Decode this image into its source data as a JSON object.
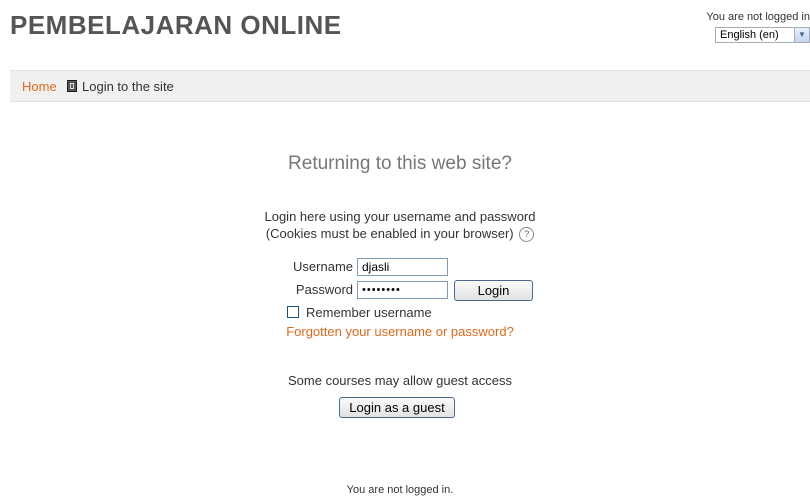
{
  "header": {
    "site_title": "PEMBELAJARAN ONLINE",
    "login_info": "You are not logged in",
    "language_selected": "English (en)"
  },
  "navbar": {
    "home": "Home",
    "current": "Login to the site"
  },
  "login": {
    "heading": "Returning to this web site?",
    "intro": "Login here using your username and password",
    "cookies_note": "(Cookies must be enabled in your browser)",
    "username_label": "Username",
    "username_value": "djasli",
    "password_label": "Password",
    "password_value": "••••••••",
    "login_button": "Login",
    "remember_label": "Remember username",
    "remember_checked": false,
    "forgot_link": "Forgotten your username or password?"
  },
  "guest": {
    "text": "Some courses may allow guest access",
    "button": "Login as a guest"
  },
  "footer": {
    "login_info": "You are not logged in."
  },
  "colors": {
    "link": "#dd6a1b",
    "title": "#555555",
    "navbar_bg": "#f0f0f0"
  }
}
